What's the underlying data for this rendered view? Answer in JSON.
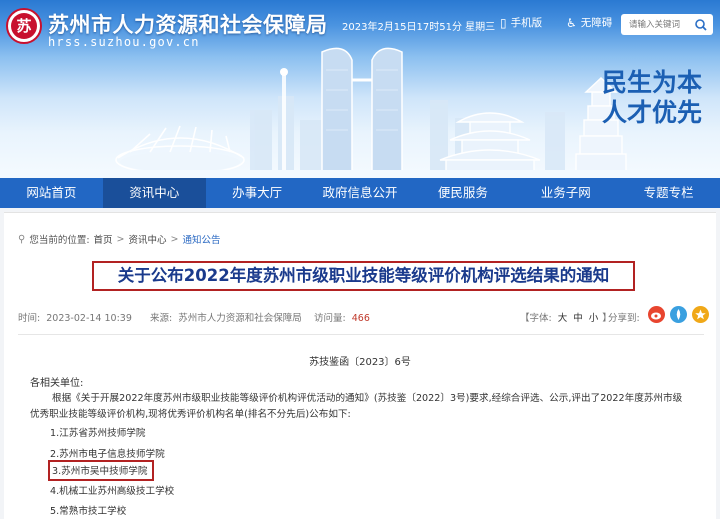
{
  "header": {
    "logo_text": "苏",
    "site_title": "苏州市人力资源和社会保障局",
    "site_domain": "hrss.suzhou.gov.cn",
    "datetime": "2023年2月15日17时51分 星期三",
    "mobile_label": "手机版",
    "accessibility_label": "无障碍",
    "search_placeholder": "请输入关键词",
    "slogan_line1": "民生为本",
    "slogan_line2": "人才优先"
  },
  "nav": {
    "items": [
      {
        "label": "网站首页"
      },
      {
        "label": "资讯中心",
        "active": true
      },
      {
        "label": "办事大厅"
      },
      {
        "label": "政府信息公开"
      },
      {
        "label": "便民服务"
      },
      {
        "label": "业务子网"
      },
      {
        "label": "专题专栏"
      }
    ]
  },
  "breadcrumb": {
    "prefix": "您当前的位置:",
    "items": [
      "首页",
      "资讯中心",
      "通知公告"
    ],
    "separator": ">"
  },
  "article": {
    "title": "关于公布2022年度苏州市级职业技能等级评价机构评选结果的通知",
    "time_label": "时间:",
    "time_value": "2023-02-14 10:39",
    "source_label": "来源:",
    "source_value": "苏州市人力资源和社会保障局",
    "views_label": "访问量:",
    "views_value": "466",
    "font_label": "【字体:",
    "font_large": "大",
    "font_medium": "中",
    "font_small": "小",
    "font_close": "】",
    "share_label": "分享到:",
    "doc_number": "苏技鉴函〔2023〕6号",
    "salutation": "各相关单位:",
    "body_line1": "根据《关于开展2022年度苏州市级职业技能等级评价机构评优活动的通知》(苏技鉴〔2022〕3号)要求,经综合评选、公示,评出了2022年度苏州市级",
    "body_line2": "优秀职业技能等级评价机构,现将优秀评价机构名单(排名不分先后)公布如下:",
    "list": [
      "1.江苏省苏州技师学院",
      "2.苏州市电子信息技师学院",
      "3.苏州市吴中技师学院",
      "4.机械工业苏州高级技工学校",
      "5.常熟市技工学校"
    ]
  },
  "colors": {
    "nav_bg": "#2267c4",
    "nav_active": "#1a4f9a",
    "title_text": "#1a3a8c",
    "highlight_border": "#b22222",
    "views_number": "#c0392b",
    "share_weibo": "#e8452f",
    "share_qzone": "#3aa0e0",
    "share_other": "#f0a818"
  },
  "icons": [
    "logo-icon",
    "mobile-icon",
    "accessibility-icon",
    "search-icon",
    "location-icon",
    "weibo-share-icon",
    "qzone-share-icon",
    "star-share-icon"
  ]
}
